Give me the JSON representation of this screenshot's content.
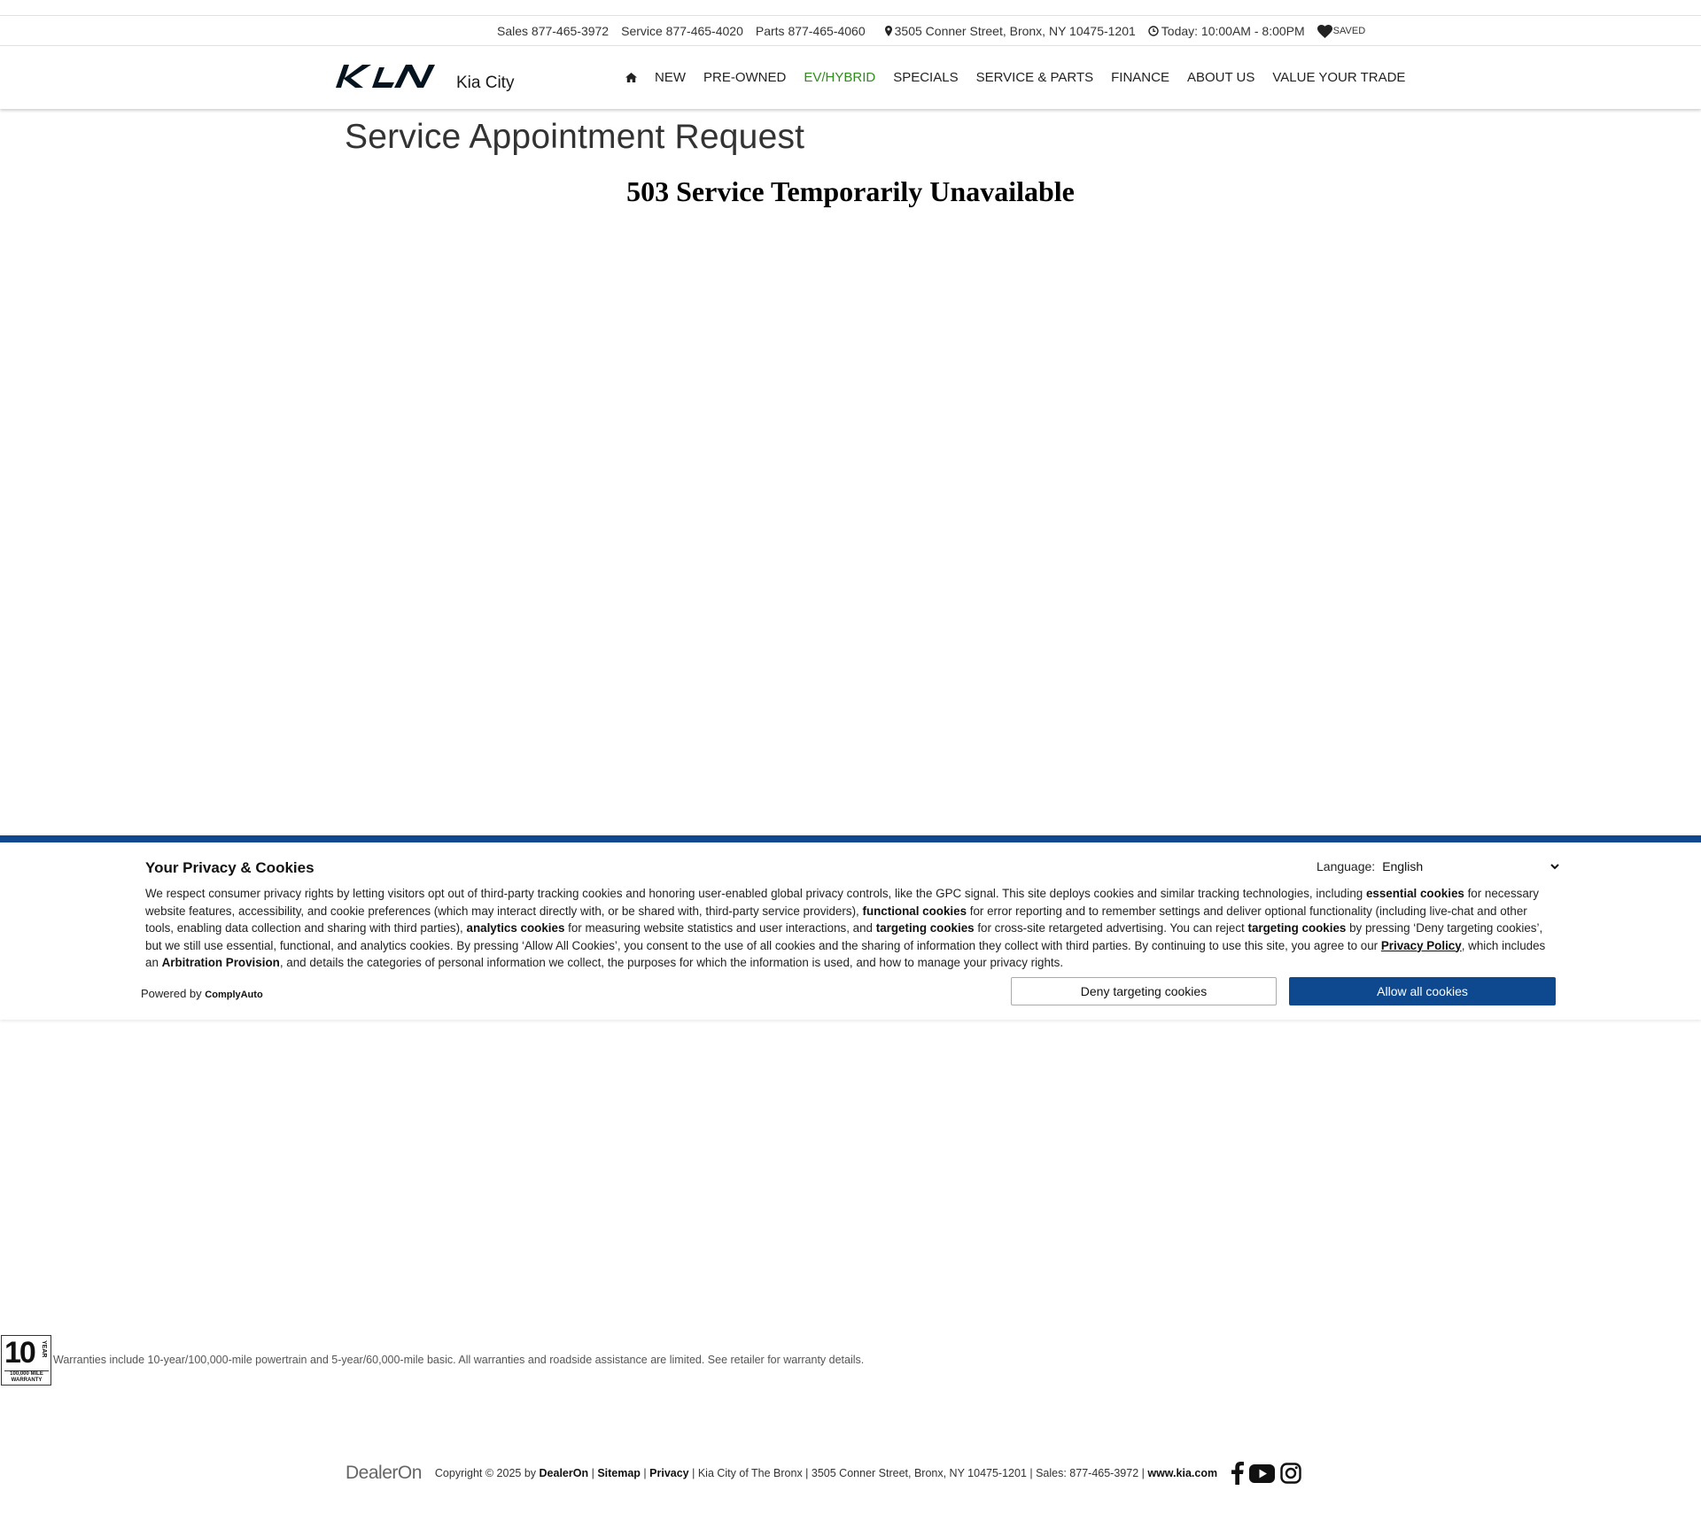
{
  "utility": {
    "sales": "Sales 877-465-3972",
    "service": "Service 877-465-4020",
    "parts": "Parts 877-465-4060",
    "address": "3505 Conner Street, Bronx, NY 10475-1201",
    "hours": "Today: 10:00AM - 8:00PM",
    "saved": "SAVED"
  },
  "header": {
    "dealer_name": "Kia City",
    "nav": [
      "NEW",
      "PRE-OWNED",
      "EV/HYBRID",
      "SPECIALS",
      "SERVICE & PARTS",
      "FINANCE",
      "ABOUT US",
      "VALUE YOUR TRADE"
    ],
    "highlight_color": "#2f8c1c"
  },
  "main": {
    "title": "Service Appointment Request",
    "error": "503 Service Temporarily Unavailable"
  },
  "cookie": {
    "title": "Your Privacy & Cookies",
    "language_label": "Language:",
    "language_value": "English",
    "body_1": "We respect consumer privacy rights by letting visitors opt out of third-party tracking cookies and honoring user-enabled global privacy controls, like the GPC signal. This site deploys cookies and similar tracking technologies, including ",
    "essential": "essential cookies",
    "body_2": " for necessary website features, accessibility, and cookie preferences (which may interact directly with, or be shared with, third-party service providers), ",
    "functional": "functional cookies",
    "body_3": " for error reporting and to remember settings and deliver optional functionality (including live-chat and other tools, enabling data collection and sharing with third parties), ",
    "analytics": "analytics cookies",
    "body_4": " for measuring website statistics and user interactions, and ",
    "targeting": "targeting cookies",
    "body_5": " for cross-site retargeted advertising. You can reject ",
    "targeting_2": "targeting cookies",
    "body_6": " by pressing ‘Deny targeting cookies’, but we still use essential, functional, and analytics cookies. By pressing ‘Allow All Cookies’, you consent to the use of all cookies and the sharing of information they collect with third parties. By continuing to use this site, you agree to our ",
    "privacy_policy": "Privacy Policy",
    "body_7": ", which includes an ",
    "arbitration": "Arbitration Provision",
    "body_8": ", and details the categories of personal information we collect, the purposes for which the information is used, and how to manage your privacy rights.",
    "powered_by": "Powered by",
    "powered_brand": "ComplyAuto",
    "deny_label": "Deny targeting cookies",
    "allow_label": "Allow all cookies",
    "accent": "#0e4990"
  },
  "warranty": {
    "badge_number": "10",
    "badge_year": "YEAR",
    "badge_miles": "100,000 MILE",
    "badge_warranty": "WARRANTY",
    "text": "Warranties include 10-year/100,000-mile powertrain and 5-year/60,000-mile basic. All warranties and roadside assistance are limited. See retailer for warranty details."
  },
  "footer": {
    "logo": "DealerOn",
    "copyright": "Copyright © 2025 by",
    "dealeron_link": "DealerOn",
    "sep1": " | ",
    "sitemap": "Sitemap",
    "sep2": " | ",
    "privacy": "Privacy",
    "info": " | Kia City of The Bronx | 3505 Conner Street, Bronx, NY 10475-1201 | Sales: 877-465-3972 | ",
    "kia_link": "www.kia.com"
  }
}
